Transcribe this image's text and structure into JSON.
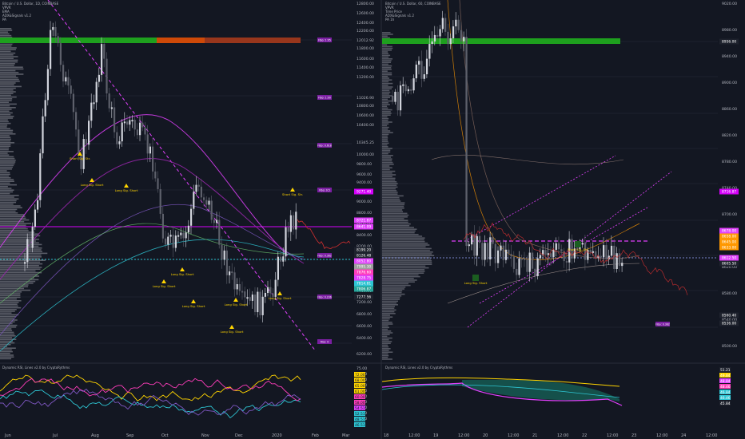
{
  "colors": {
    "background": "#131722",
    "up": "#d1d4dc",
    "down": "#5d606b",
    "accent_magenta": "#e040fb",
    "accent_pink": "#ff3dbb",
    "accent_yellow": "#ffd400",
    "accent_cyan": "#2ec5d3",
    "accent_green": "#1ea01e",
    "accent_red": "#d32f2f"
  },
  "left_chart": {
    "legend": [
      "Bitcoin / U.S. Dollar, 1D, COINBASE",
      "VPVR",
      "EMA",
      "ADX&Signals v1.2",
      "PA"
    ],
    "price_axis": [
      "12800.00",
      "12600.00",
      "12400.00",
      "12200.00",
      "12012.92",
      "11800.00",
      "11600.00",
      "11400.00",
      "11200.00",
      "11026.90",
      "10800.00",
      "10600.00",
      "10400.00",
      "10345.25",
      "10000.00",
      "9800.00",
      "9600.00",
      "9400.00",
      "9271.40",
      "9000.00",
      "8800.00",
      "8600.00",
      "8400.00",
      "8200.00",
      "8000.00",
      "7800.00",
      "7600.00",
      "7400.00",
      "7200.00",
      "6800.00",
      "6600.00",
      "6400.00",
      "6200.00"
    ],
    "tags": [
      {
        "text": "9271.40",
        "color": "#d500f9"
      },
      {
        "text": "8721.87",
        "color": "#e040fb"
      },
      {
        "text": "8641.09",
        "color": "#e040fb"
      },
      {
        "text": "8199.20",
        "color": "#1e222d"
      },
      {
        "text": "8126.48",
        "color": "#1e222d"
      },
      {
        "text": "8052.80",
        "color": "#e040fb"
      },
      {
        "text": "7995.30",
        "color": "#9e9e9e"
      },
      {
        "text": "7876.60",
        "color": "#ff3dbb"
      },
      {
        "text": "7828.75",
        "color": "#e040fb"
      },
      {
        "text": "7814.81",
        "color": "#2ec5d3"
      },
      {
        "text": "7806.87",
        "color": "#26a69a"
      },
      {
        "text": "7277.56",
        "color": "#1e222d"
      }
    ],
    "fibs": [
      "Fibo: 1:05",
      "Fibo: 1:00",
      "Fibo: 0.618",
      "Fibo: 0.5",
      "Fibo: 0.382",
      "Fibo: 0.236",
      "Fibo: 0"
    ],
    "annotations": [
      "Short Sig. Str.",
      "Long Sig. Short",
      "Long Sig. Short",
      "Long Sig. Short",
      "Long Sig. Short",
      "Long Sig. Short",
      "Long Sig. Short",
      "Long Sig. Short",
      "Long Sig. Short",
      "Short Sig. Str."
    ],
    "time_axis": [
      "Jun",
      "Jul",
      "Aug",
      "Sep",
      "Oct",
      "Nov",
      "Dec",
      "2020",
      "Feb",
      "Mar"
    ],
    "osc_legend": "Dynamic RSI, Lines v2.0 by CryptoRythms",
    "osc_axis": [
      "75.00",
      "70.00",
      "65.00",
      "61.00",
      "55.00",
      "50.00",
      "45.00",
      "40.00",
      "35.00",
      "30.00"
    ],
    "osc_tags": [
      {
        "text": "72.00",
        "color": "#ffd400"
      },
      {
        "text": "68.00",
        "color": "#ffd400"
      },
      {
        "text": "65.00",
        "color": "#ffd400"
      },
      {
        "text": "61.00",
        "color": "#ffd400"
      },
      {
        "text": "60.00",
        "color": "#ff3dbb"
      },
      {
        "text": "58.00",
        "color": "#ff3dbb"
      },
      {
        "text": "54.51",
        "color": "#e040fb"
      },
      {
        "text": "52.51",
        "color": "#2ec5d3"
      },
      {
        "text": "48.51",
        "color": "#2ec5d3"
      },
      {
        "text": "46.51",
        "color": "#2ec5d3"
      }
    ]
  },
  "right_chart": {
    "legend": [
      "Bitcoin / U.S. Dollar, 60, COINBASE",
      "VPVR",
      "Time Price",
      "ADX&Signals v1.2",
      "PA 1h"
    ],
    "price_axis": [
      "9020.00",
      "8980.00",
      "8940.00",
      "8900.00",
      "8860.00",
      "8820.00",
      "8780.00",
      "8740.00",
      "8700.00",
      "8660.00",
      "8620.00",
      "8580.00",
      "8540.00",
      "8500.00"
    ],
    "tags": [
      {
        "text": "8956.00",
        "color": "#1e222d"
      },
      {
        "text": "8716.87",
        "color": "#d500f9"
      },
      {
        "text": "8678.00",
        "color": "#e040fb"
      },
      {
        "text": "8658.00",
        "color": "#ff9800"
      },
      {
        "text": "8645.00",
        "color": "#ff9800"
      },
      {
        "text": "8633.00",
        "color": "#ff9800"
      },
      {
        "text": "8612.50",
        "color": "#e040fb"
      },
      {
        "text": "8605.50",
        "color": "#1e222d"
      },
      {
        "text": "8560.40",
        "color": "#1e222d"
      },
      {
        "text": "8536.00",
        "color": "#1e222d"
      }
    ],
    "fibs": [
      "Fibo: 0.382"
    ],
    "annotations": [
      "Long Sig. Short",
      "Short Sig. Str."
    ],
    "time_axis": [
      "18",
      "12:00",
      "19",
      "12:00",
      "20",
      "12:00",
      "21",
      "12:00",
      "22",
      "12:00",
      "23",
      "12:00",
      "24",
      "12:00"
    ],
    "osc_legend": "Dynamic RSI, Lines v2.0 by CryptoRythms",
    "osc_tags": [
      {
        "text": "51.21",
        "color": "#1e222d"
      },
      {
        "text": "49.84",
        "color": "#ffd400"
      },
      {
        "text": "48.84",
        "color": "#e040fb"
      },
      {
        "text": "48.46",
        "color": "#ff3dbb"
      },
      {
        "text": "46.84",
        "color": "#2ec5d3"
      },
      {
        "text": "46.46",
        "color": "#2ec5d3"
      },
      {
        "text": "45.84",
        "color": "#1e222d"
      }
    ]
  },
  "chart_data": [
    {
      "type": "candlestick",
      "title": "Bitcoin / U.S. Dollar, 1D, COINBASE",
      "x": [
        "Jun",
        "Jul",
        "Aug",
        "Sep",
        "Oct",
        "Nov",
        "Dec",
        "2020"
      ],
      "close": [
        8600,
        11800,
        10500,
        10300,
        8200,
        9200,
        7300,
        8700
      ],
      "ylim": [
        6100,
        12900
      ]
    },
    {
      "type": "candlestick",
      "title": "Bitcoin / U.S. Dollar, 60, COINBASE",
      "x": [
        "18",
        "19",
        "20",
        "21",
        "22",
        "23",
        "24"
      ],
      "close": [
        8960,
        8960,
        8600,
        8620,
        8640,
        8700,
        8600
      ],
      "ylim": [
        8480,
        9030
      ]
    }
  ]
}
